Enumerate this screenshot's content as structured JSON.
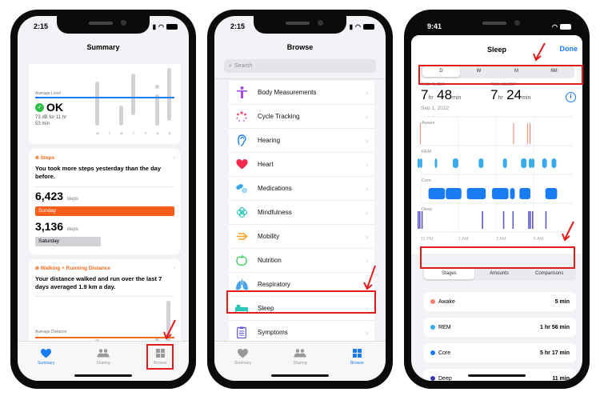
{
  "phones": [
    {
      "time": "2:15",
      "battery": "48",
      "nav_title": "Summary",
      "noise_card": {
        "average_label": "Average Level",
        "status": "OK",
        "detail_line1": "73 dB for 11 hr",
        "detail_line2": "53 min",
        "days": [
          "M",
          "T",
          "W",
          "T",
          "F",
          "S",
          "S"
        ]
      },
      "steps_card": {
        "title": "Steps",
        "message": "You took more steps yesterday than the day before.",
        "today_value": "6,423",
        "today_unit": "steps",
        "today_day": "Sunday",
        "prev_value": "3,136",
        "prev_unit": "steps",
        "prev_day": "Saturday"
      },
      "distance_card": {
        "title": "Walking + Running Distance",
        "message": "Your distance walked and run over the last 7 days averaged 1.9 km a day.",
        "average_label": "Average Distance",
        "partial_value": "1.9"
      },
      "tabs": [
        {
          "label": "Summary",
          "icon": "heart-icon",
          "active": true
        },
        {
          "label": "Sharing",
          "icon": "people-icon",
          "active": false
        },
        {
          "label": "Browse",
          "icon": "grid-icon",
          "active": false
        }
      ]
    },
    {
      "time": "2:15",
      "battery": "48",
      "nav_title": "Browse",
      "search_placeholder": "Search",
      "categories": [
        {
          "label": "Body Measurements",
          "icon": "body-measurements-icon",
          "color": "#a74be0"
        },
        {
          "label": "Cycle Tracking",
          "icon": "cycle-tracking-icon",
          "color": "#f2466a"
        },
        {
          "label": "Hearing",
          "icon": "hearing-icon",
          "color": "#1a7cf5"
        },
        {
          "label": "Heart",
          "icon": "heart-icon",
          "color": "#f5294d"
        },
        {
          "label": "Medications",
          "icon": "medications-icon",
          "color": "#35a3e8"
        },
        {
          "label": "Mindfulness",
          "icon": "mindfulness-icon",
          "color": "#2cc5b8"
        },
        {
          "label": "Mobility",
          "icon": "mobility-icon",
          "color": "#f4a223"
        },
        {
          "label": "Nutrition",
          "icon": "nutrition-icon",
          "color": "#35c759"
        },
        {
          "label": "Respiratory",
          "icon": "respiratory-icon",
          "color": "#4aa4e8"
        },
        {
          "label": "Sleep",
          "icon": "sleep-icon",
          "color": "#2cc5b8"
        },
        {
          "label": "Symptoms",
          "icon": "symptoms-icon",
          "color": "#5856d6"
        }
      ],
      "tabs": [
        {
          "label": "Summary",
          "icon": "heart-icon",
          "active": false
        },
        {
          "label": "Sharing",
          "icon": "people-icon",
          "active": false
        },
        {
          "label": "Browse",
          "icon": "grid-icon",
          "active": true
        }
      ]
    },
    {
      "time": "9:41",
      "nav_title": "Sleep",
      "done_label": "Done",
      "range_tabs": [
        "D",
        "W",
        "M",
        "6M"
      ],
      "range_selected": "D",
      "time_in_bed_label": "TIME IN BED",
      "time_in_bed": {
        "hr": "7",
        "hr_unit": "hr",
        "min": "48",
        "min_unit": "min"
      },
      "time_asleep_label": "TIME ASLEEP",
      "time_asleep": {
        "hr": "7",
        "hr_unit": "hr",
        "min": "24",
        "min_unit": "min"
      },
      "date": "Sep 1, 2022",
      "chart_rows": [
        "Awake",
        "REM",
        "Core",
        "Deep"
      ],
      "chart_times": [
        "11 PM",
        "1 AM",
        "3 AM",
        "5 AM"
      ],
      "view_tabs": [
        "Stages",
        "Amounts",
        "Comparisons"
      ],
      "view_selected": "Stages",
      "stages": [
        {
          "name": "Awake",
          "value": "5 min",
          "color": "#f47f6c"
        },
        {
          "name": "REM",
          "value": "1 hr 56 min",
          "color": "#3aabea"
        },
        {
          "name": "Core",
          "value": "5 hr 17 min",
          "color": "#1a7cf5"
        },
        {
          "name": "Deep",
          "value": "11 min",
          "color": "#3a3aa8"
        }
      ]
    }
  ]
}
